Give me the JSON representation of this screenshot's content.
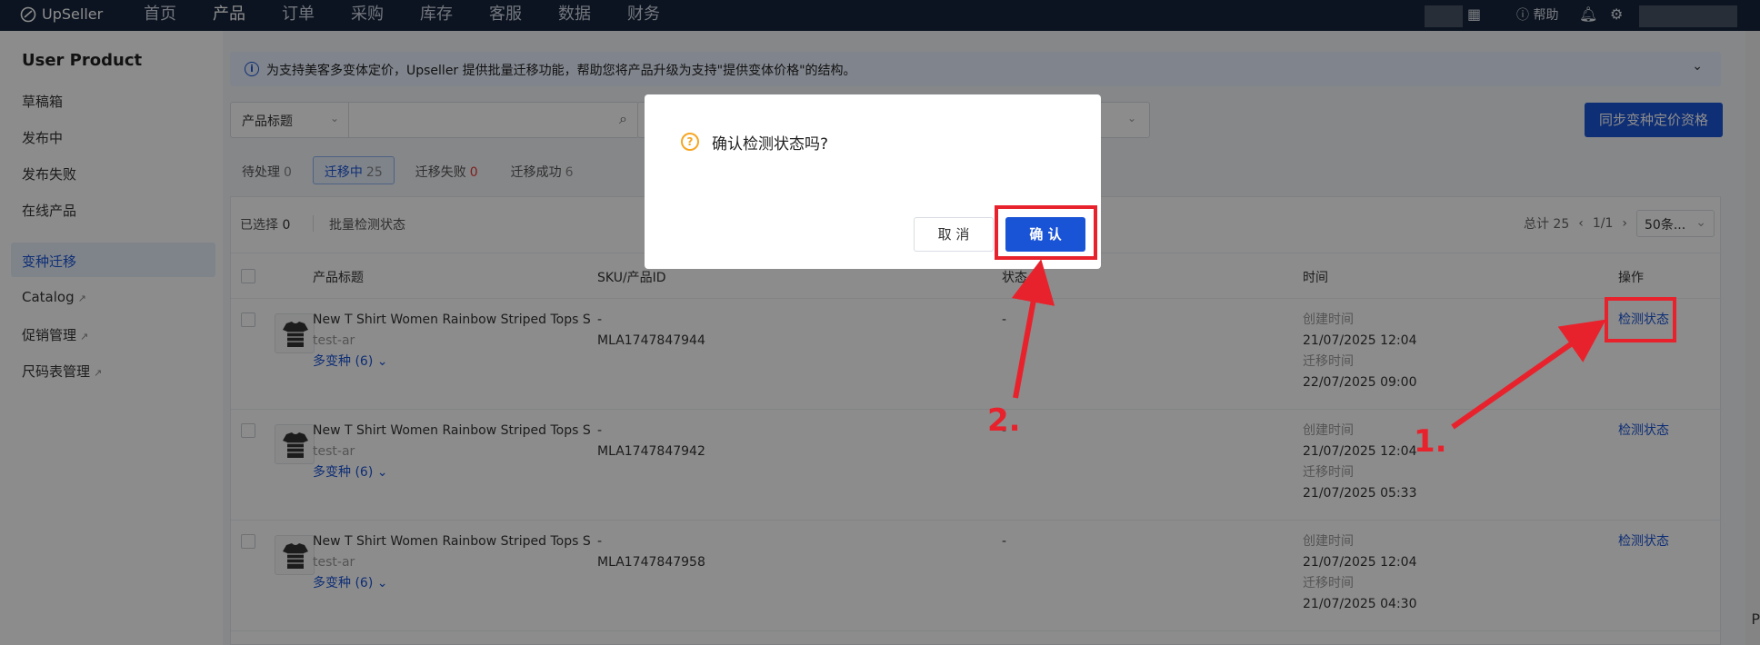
{
  "app": {
    "logo": "UpSeller"
  },
  "nav": {
    "items": [
      "首页",
      "产品",
      "订单",
      "采购",
      "库存",
      "客服",
      "数据",
      "财务"
    ],
    "active": 1,
    "help": "帮助"
  },
  "sidebar": {
    "title": "User Product",
    "items": [
      "草稿箱",
      "发布中",
      "发布失败",
      "在线产品",
      "变种迁移",
      "Catalog",
      "促销管理",
      "尺码表管理"
    ],
    "active_index": 4
  },
  "banner": {
    "text": "为支持美客多变体定价，Upseller 提供批量迁移功能，帮助您将产品升级为支持\"提供变体价格\"的结构。"
  },
  "filter": {
    "select_label": "产品标题",
    "input_value": ""
  },
  "sync_button": "同步变种定价资格",
  "tabs": [
    {
      "label": "待处理",
      "count": "0"
    },
    {
      "label": "迁移中",
      "count": "25"
    },
    {
      "label": "迁移失败",
      "count": "0"
    },
    {
      "label": "迁移成功",
      "count": "6"
    }
  ],
  "toolbar": {
    "selected_label": "已选择",
    "selected_count": "0",
    "batch_label": "批量检测状态"
  },
  "pager": {
    "total": "总计 25",
    "page": "1/1",
    "size": "50条..."
  },
  "columns": [
    "产品标题",
    "SKU/产品ID",
    "状态",
    "时间",
    "操作"
  ],
  "rows": [
    {
      "title": "New T Shirt Women Rainbow Striped Tops S",
      "store": "test-ar",
      "variants": "多变种 (6)",
      "sku": "-",
      "id": "MLA1747847944",
      "status": "-",
      "created_label": "创建时间",
      "created": "21/07/2025 12:04",
      "migrated_label": "迁移时间",
      "migrated": "22/07/2025 09:00",
      "action": "检测状态"
    },
    {
      "title": "New T Shirt Women Rainbow Striped Tops S",
      "store": "test-ar",
      "variants": "多变种 (6)",
      "sku": "-",
      "id": "MLA1747847942",
      "status": "-",
      "created_label": "创建时间",
      "created": "21/07/2025 12:04",
      "migrated_label": "迁移时间",
      "migrated": "21/07/2025 05:33",
      "action": "检测状态"
    },
    {
      "title": "New T Shirt Women Rainbow Striped Tops S",
      "store": "test-ar",
      "variants": "多变种 (6)",
      "sku": "-",
      "id": "MLA1747847958",
      "status": "-",
      "created_label": "创建时间",
      "created": "21/07/2025 12:04",
      "migrated_label": "迁移时间",
      "migrated": "21/07/2025 04:30",
      "action": "检测状态"
    }
  ],
  "modal": {
    "title": "确认检测状态吗?",
    "cancel": "取 消",
    "confirm": "确 认"
  },
  "annotations": {
    "label_1": "1.",
    "label_2": "2.",
    "color": "#e8222c"
  },
  "colors": {
    "accent": "#1a54d6",
    "nav_bg": "#17253d",
    "warning": "#f5a623"
  },
  "edge_text": "P"
}
